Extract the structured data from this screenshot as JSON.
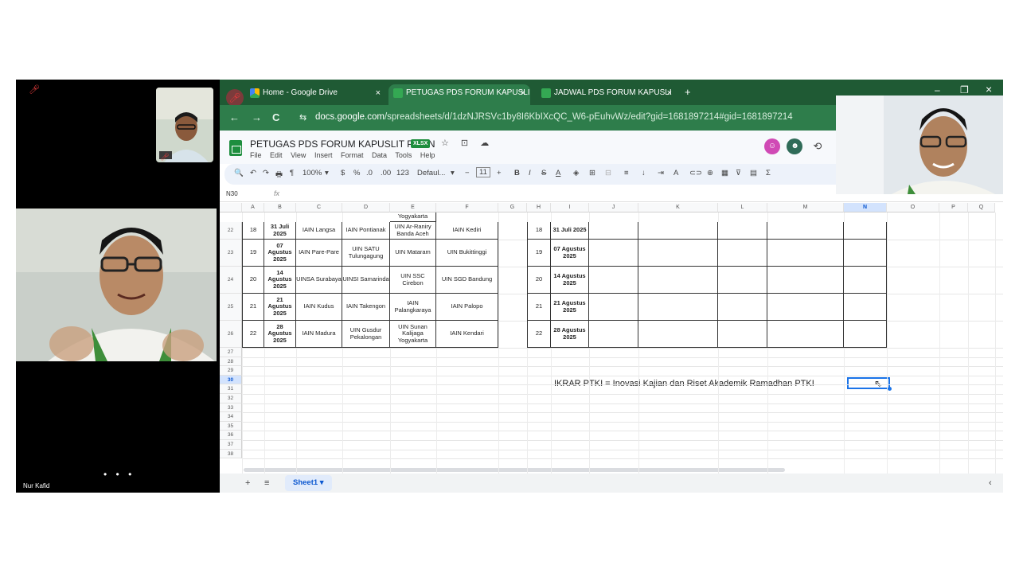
{
  "participants": [
    {
      "id": "small-top",
      "muted": true
    },
    {
      "id": "speaker",
      "name": "Nur Kafid"
    }
  ],
  "more_dots": "• • •",
  "browser": {
    "tabs": [
      {
        "label": "Home - Google Drive",
        "close": "×"
      },
      {
        "label": "PETUGAS PDS FORUM KAPUSLI",
        "close": "×"
      },
      {
        "label": "JADWAL PDS FORUM KAPUSLI",
        "close": "×"
      }
    ],
    "new_tab": "+",
    "window_controls": {
      "minimize": "–",
      "restore": "❐",
      "close": "×"
    },
    "nav": {
      "back": "←",
      "forward": "→",
      "reload": "C",
      "site_info": "⇆"
    },
    "url_host": "docs.google.com",
    "url_path": "/spreadsheets/d/1dzNJRSVc1by8I6KbIXcQC_W6-pEuhvWz/edit?gid=1681897214#gid=1681897214"
  },
  "doc": {
    "title": "PETUGAS PDS FORUM KAPUSLIT PTKIN",
    "badge": "XLSX",
    "title_icons": "☆ ⊡ ☁",
    "menus": [
      "File",
      "Edit",
      "View",
      "Insert",
      "Format",
      "Data",
      "Tools",
      "Help"
    ]
  },
  "toolbar": {
    "items": [
      "🔍",
      "↶",
      "↷",
      "🖶",
      "¶",
      "100%",
      "▾",
      "$",
      "%",
      ".0",
      ".00",
      "123",
      "Defaul...",
      "▾",
      "−",
      "11",
      "+",
      "B",
      "I",
      "S",
      "A",
      "◈",
      "⊞",
      "⊟",
      "≡",
      "↓",
      "⇥",
      "A",
      "⊂⊃",
      "⊕",
      "▦",
      "⊽",
      "▤",
      "Σ"
    ]
  },
  "formula_bar": {
    "cell_ref": "N30",
    "fx": "fx"
  },
  "columns": [
    "A",
    "B",
    "C",
    "D",
    "E",
    "F",
    "G",
    "H",
    "I",
    "J",
    "K",
    "L",
    "M",
    "N",
    "O",
    "P",
    "Q"
  ],
  "selected_column": "N",
  "rows": [
    "22",
    "23",
    "24",
    "25",
    "26",
    "27",
    "28",
    "29",
    "30",
    "31",
    "32",
    "33",
    "34",
    "35",
    "36",
    "37",
    "38"
  ],
  "selected_row": "30",
  "partial_top": {
    "e": "Yogyakarta"
  },
  "table_left": [
    {
      "no": "18",
      "date": "31 Juli 2025",
      "c": "IAIN Langsa",
      "d": "IAIN Pontianak",
      "e": "UIN Ar-Raniry Banda Aceh",
      "f": "IAIN Kediri"
    },
    {
      "no": "19",
      "date": "07 Agustus 2025",
      "c": "IAIN Pare-Pare",
      "d": "UIN SATU Tulungagung",
      "e": "UIN Mataram",
      "f": "UIN Bukittinggi"
    },
    {
      "no": "20",
      "date": "14 Agustus 2025",
      "c": "UINSA Surabaya",
      "d": "UINSI Samarinda",
      "e": "UIN SSC Cirebon",
      "f": "UIN SGD Bandung"
    },
    {
      "no": "21",
      "date": "21 Agustus 2025",
      "c": "IAIN Kudus",
      "d": "IAIN Takengon",
      "e": "IAIN Palangkaraya",
      "f": "IAIN Palopo"
    },
    {
      "no": "22",
      "date": "28 Agustus 2025",
      "c": "IAIN Madura",
      "d": "UIN Gusdur Pekalongan",
      "e": "UIN Sunan Kalijaga Yogyakarta",
      "f": "IAIN Kendari"
    }
  ],
  "table_right": [
    {
      "no": "18",
      "date": "31 Juli 2025"
    },
    {
      "no": "19",
      "date": "07 Agustus 2025"
    },
    {
      "no": "20",
      "date": "14 Agustus 2025"
    },
    {
      "no": "21",
      "date": "21 Agustus 2025"
    },
    {
      "no": "22",
      "date": "28 Agustus 2025"
    }
  ],
  "note_text": "IKRAR PTKI = Inovasi Kajian dan Riset Akademik Ramadhan PTKI",
  "sheetbar": {
    "add": "+",
    "menu": "≡",
    "sheet_name": "Sheet1",
    "caret": "▾",
    "collapse": "‹"
  },
  "colors": {
    "tabbar": "#1f5a34",
    "addressbar": "#2e7d4b",
    "sheets_green": "#1e8e3e",
    "selection": "#1a73e8"
  }
}
